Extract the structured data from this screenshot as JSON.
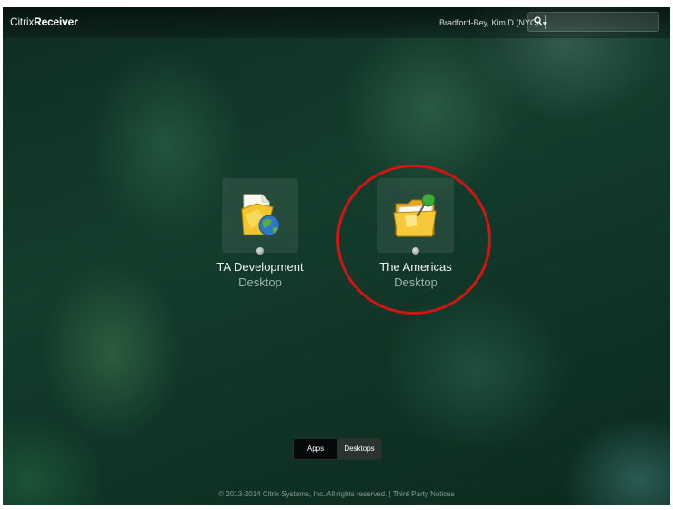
{
  "header": {
    "logo_light": "Citrix",
    "logo_bold": "Receiver",
    "user": "Bradford-Bey, Kim D (NYC)",
    "user_caret": "▼",
    "search_placeholder": ""
  },
  "tiles": [
    {
      "name": "TA Development",
      "type": "Desktop",
      "icon": "desktop-folder-globe-icon"
    },
    {
      "name": "The Americas",
      "type": "Desktop",
      "icon": "desktop-folder-pin-icon"
    }
  ],
  "toggle": {
    "apps_label": "Apps",
    "desktops_label": "Desktops"
  },
  "footer": {
    "copyright": "© 2013-2014 Citrix Systems, Inc. All rights reserved.",
    "separator": "|",
    "link": "Third Party Notices"
  },
  "colors": {
    "highlight": "#d21414"
  }
}
